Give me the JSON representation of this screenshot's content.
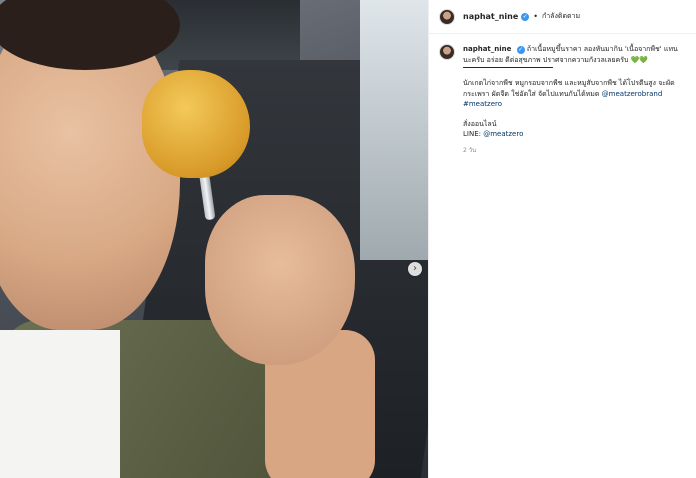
{
  "post": {
    "username": "naphat_nine",
    "follow_status": "กำลังติดตาม",
    "separator": "•",
    "verified_mark": "✓",
    "caption_intro": "ถ้าเนื้อหมูขึ้นราคา ลองหันมากิน 'เนื้อจากพืช' แทนนะครับ อร่อย ดีต่อสุขภาพ ปราศจากความกังวลเลยครับ 💚💚",
    "caption_body": "นักเกตไก่จากพืช หมูกรอบจากพืช และหมูสับจากพืช ได้โปรตีนสูง จะผัดกระเพรา ผัดจืด ใช่อัดใส่ จัดไปแทนกันได้หมด",
    "mention_brand": "@meatzerobrand",
    "hashtag": "#meatzero",
    "order_label": "สั่งออนไลน์",
    "line_label": "LINE:",
    "line_handle": "@meatzero",
    "time_ago": "2 วัน"
  },
  "carousel": {
    "next_icon": "›"
  }
}
